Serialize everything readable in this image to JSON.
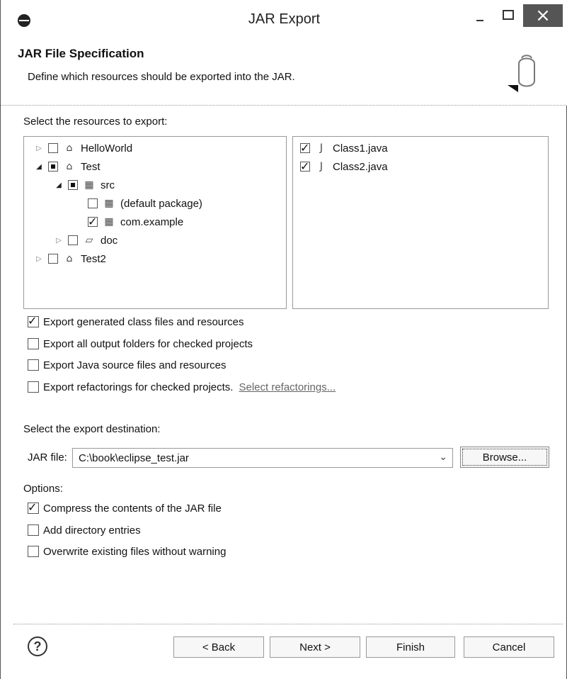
{
  "window": {
    "title": "JAR Export"
  },
  "header": {
    "title": "JAR File Specification",
    "description": "Define which resources should be exported into the JAR."
  },
  "resources": {
    "label": "Select the resources to export:",
    "tree": [
      {
        "label": "HelloWorld",
        "state": "unchecked",
        "expander": "closed",
        "icon": "project-icon"
      },
      {
        "label": "Test",
        "state": "mixed",
        "expander": "open",
        "icon": "project-icon"
      },
      {
        "label": "src",
        "state": "mixed",
        "expander": "open",
        "icon": "source-folder-icon"
      },
      {
        "label": "(default package)",
        "state": "unchecked",
        "expander": "none",
        "icon": "package-icon"
      },
      {
        "label": "com.example",
        "state": "checked",
        "expander": "none",
        "icon": "package-icon"
      },
      {
        "label": "doc",
        "state": "unchecked",
        "expander": "closed",
        "icon": "folder-icon"
      },
      {
        "label": "Test2",
        "state": "unchecked",
        "expander": "closed",
        "icon": "project-icon"
      }
    ],
    "files": [
      {
        "label": "Class1.java",
        "state": "checked",
        "icon": "java-file-icon"
      },
      {
        "label": "Class2.java",
        "state": "checked",
        "icon": "java-file-icon"
      }
    ]
  },
  "export_options": [
    {
      "label": "Export generated class files and resources",
      "checked": true
    },
    {
      "label": "Export all output folders for checked projects",
      "checked": false
    },
    {
      "label": "Export Java source files and resources",
      "checked": false
    },
    {
      "label": "Export refactorings for checked projects.",
      "checked": false
    }
  ],
  "refactoring_link": "Select refactorings...",
  "destination": {
    "label": "Select the export destination:",
    "jar_file_label": "JAR file:",
    "jar_file_value": "C:\\book\\eclipse_test.jar",
    "browse_label": "Browse..."
  },
  "options": {
    "label": "Options:",
    "items": [
      {
        "label": "Compress the contents of the JAR file",
        "checked": true
      },
      {
        "label": "Add directory entries",
        "checked": false
      },
      {
        "label": "Overwrite existing files without warning",
        "checked": false
      }
    ]
  },
  "footer": {
    "back_label": "< Back",
    "next_label": "Next >",
    "finish_label": "Finish",
    "cancel_label": "Cancel"
  },
  "colors": {
    "close_button": "#555555",
    "panel_border": "#999999",
    "link": "#666666"
  }
}
